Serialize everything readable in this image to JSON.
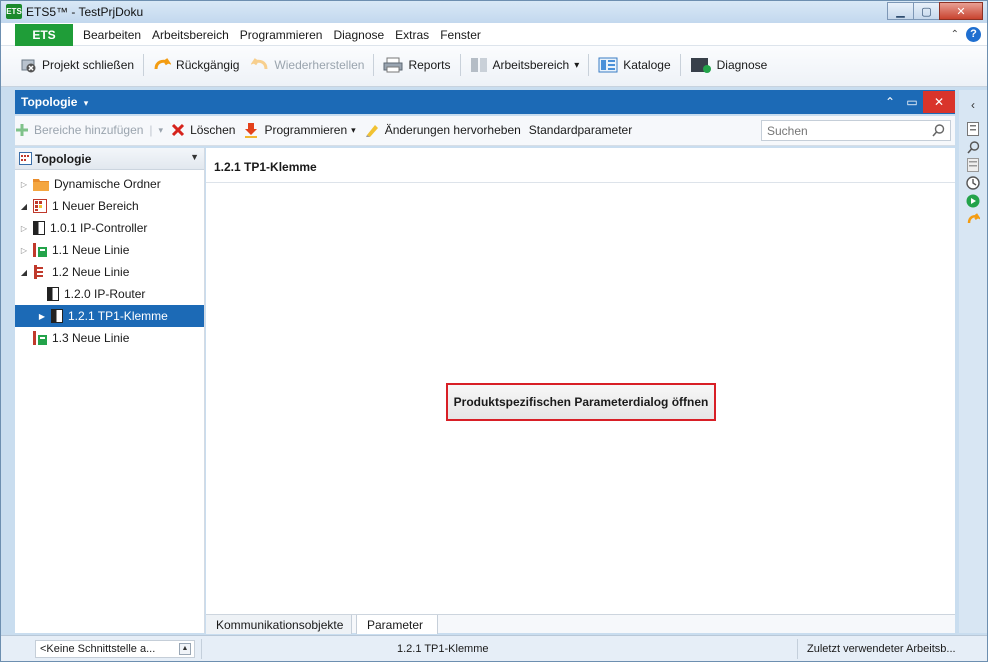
{
  "window": {
    "title": "ETS5™ - TestPrjDoku",
    "app_icon_text": "ETS"
  },
  "menubar": {
    "ets_tab": "ETS",
    "items": [
      "Bearbeiten",
      "Arbeitsbereich",
      "Programmieren",
      "Diagnose",
      "Extras",
      "Fenster"
    ]
  },
  "toolbar": {
    "close_project": "Projekt schließen",
    "undo": "Rückgängig",
    "redo": "Wiederherstellen",
    "reports": "Reports",
    "workspace": "Arbeitsbereich",
    "workspace_caret": "▾",
    "catalogs": "Kataloge",
    "diagnostics": "Diagnose"
  },
  "panel": {
    "title": "Topologie",
    "title_caret": "▾"
  },
  "subtoolbar": {
    "add_areas": "Bereiche hinzufügen",
    "add_areas_caret": "▾",
    "delete": "Löschen",
    "program": "Programmieren",
    "program_caret": "▾",
    "highlight_changes": "Änderungen hervorheben",
    "default_params": "Standardparameter",
    "search_placeholder": "Suchen"
  },
  "tree": {
    "header": "Topologie",
    "nodes": [
      {
        "label": "Dynamische Ordner",
        "expander": "▷"
      },
      {
        "label": "1 Neuer Bereich",
        "expander": "◢"
      },
      {
        "label": "1.0.1 IP-Controller",
        "expander": "▷"
      },
      {
        "label": "1.1 Neue Linie",
        "expander": "▷"
      },
      {
        "label": "1.2 Neue Linie",
        "expander": "◢"
      },
      {
        "label": "1.2.0 IP-Router",
        "expander": ""
      },
      {
        "label": "1.2.1 TP1-Klemme",
        "expander": "▶"
      },
      {
        "label": "1.3 Neue Linie",
        "expander": ""
      }
    ]
  },
  "main": {
    "title": "1.2.1 TP1-Klemme",
    "param_button": "Produktspezifischen Parameterdialog öffnen",
    "tabs": [
      "Kommunikationsobjekte",
      "Parameter"
    ]
  },
  "statusbar": {
    "interface": "<Keine Schnittstelle a...",
    "device": "1.2.1 TP1-Klemme",
    "workspace": "Zuletzt verwendeter Arbeitsb..."
  },
  "colors": {
    "accent_blue": "#1c6ab6",
    "ets_green": "#1f9d38",
    "highlight_red": "#d81f26"
  }
}
